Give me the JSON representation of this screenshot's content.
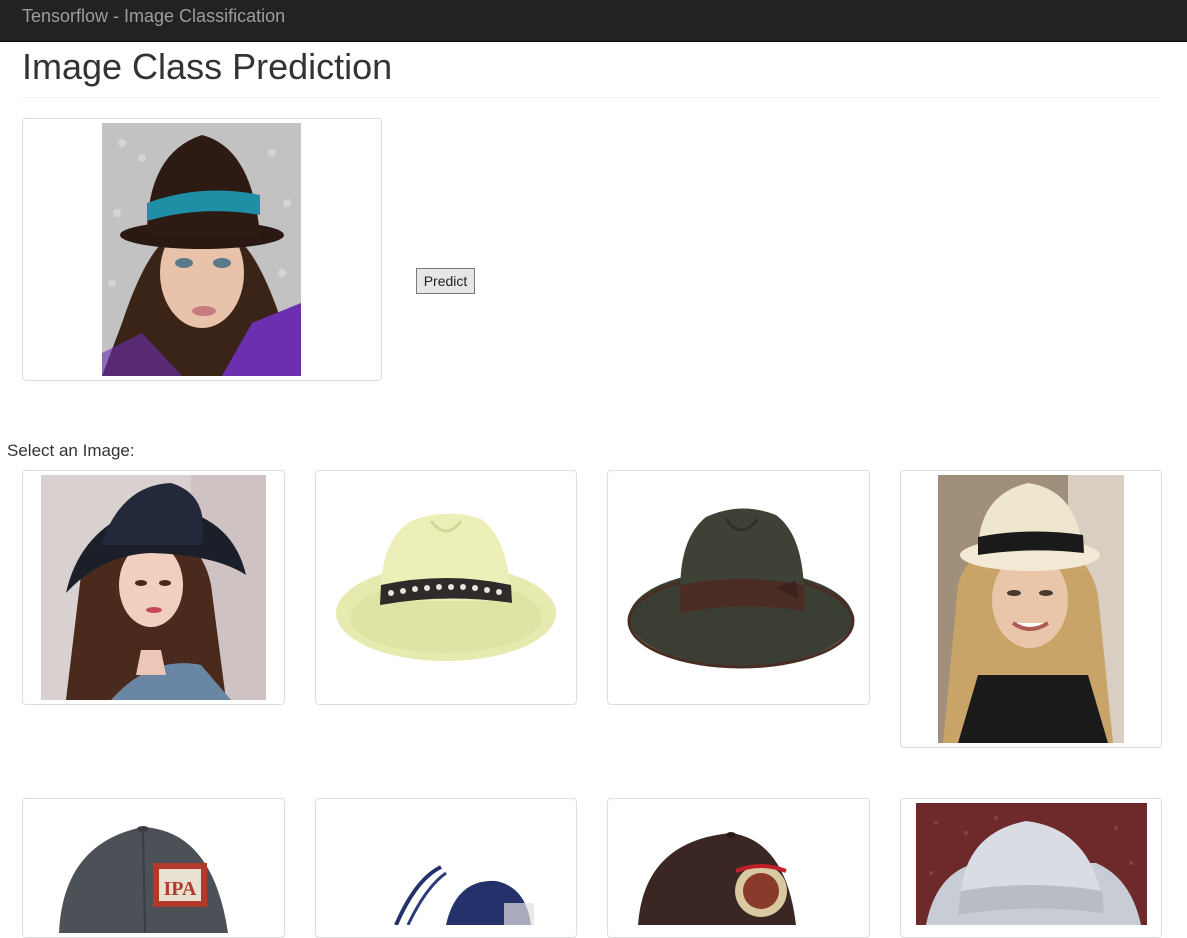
{
  "navbar": {
    "brand": "Tensorflow - Image Classification"
  },
  "header": {
    "title": "Image Class Prediction"
  },
  "preview": {
    "image": "woman in brown cloche hat with teal band"
  },
  "actions": {
    "predict_label": "Predict"
  },
  "gallery": {
    "label": "Select an Image:",
    "images": [
      "woman in navy floppy hat",
      "light yellow fedora with patterned band",
      "dark green fedora with brown band",
      "blonde woman in cream fedora",
      "grey IPA baseball cap",
      "navy fascinator hat",
      "brown baseball cap with logo",
      "light grey straw fedora"
    ]
  }
}
